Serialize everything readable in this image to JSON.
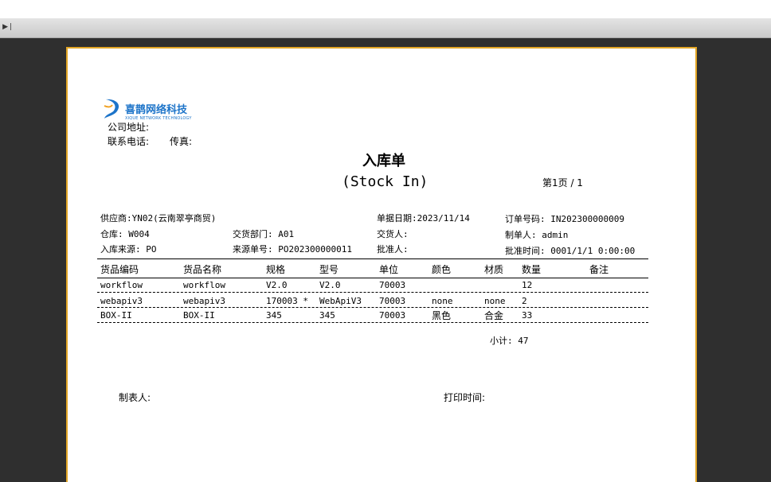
{
  "viewer": {
    "toolbar_icon": "play-next-icon"
  },
  "company": {
    "logo_text": "喜鹊网络科技",
    "logo_subtext": "XIQUE NETWORK TECHNOLOGY",
    "address_label": "公司地址:",
    "phone_label": "联系电话:",
    "fax_label": "传真:"
  },
  "title": {
    "cn": "入库单",
    "en": "(Stock In)"
  },
  "page_info": "第1页 / 1",
  "header": {
    "supplier": "供应商:YN02(云南翠亭商贸)",
    "doc_date": "单据日期:2023/11/14",
    "order_no": "订单号码: IN202300000009",
    "warehouse": "仓库: W004",
    "delivery_dept": "交货部门: A01",
    "delivered_by": "交货人:",
    "created_by": "制单人: admin",
    "source": "入库来源: PO",
    "source_no": "来源单号: PO202300000011",
    "approver": "批准人:",
    "approve_time": "批准时间: 0001/1/1 0:00:00"
  },
  "table": {
    "columns": [
      "货品编码",
      "货品名称",
      "规格",
      "型号",
      "单位",
      "颜色",
      "材质",
      "数量",
      "备注"
    ],
    "rows": [
      [
        "workflow",
        "workflow",
        "V2.0",
        "V2.0",
        "70003",
        "",
        "",
        "12",
        ""
      ],
      [
        "webapiv3",
        "webapiv3",
        "170003 *",
        "WebApiV3",
        "70003",
        "none",
        "none",
        "2",
        ""
      ],
      [
        "BOX-II",
        "BOX-II",
        "345",
        "345",
        "70003",
        "黑色",
        "合金",
        "33",
        ""
      ]
    ]
  },
  "subtotal": "小计: 47",
  "footer": {
    "maker": "制表人:",
    "print_time": "打印时间:"
  }
}
